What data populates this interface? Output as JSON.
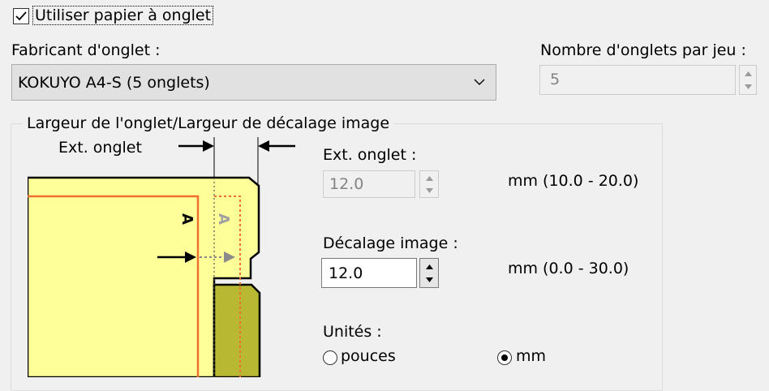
{
  "tab_paper": {
    "checkbox_label": "Utiliser papier à onglet",
    "checkbox_checked": true
  },
  "manufacturer": {
    "label": "Fabricant d'onglet :",
    "selected": "KOKUYO A4-S (5 onglets)"
  },
  "tabs_per_set": {
    "label": "Nombre d'onglets par jeu :",
    "value": "5"
  },
  "group": {
    "title": "Largeur de l'onglet/Largeur de décalage image",
    "illustration_label": "Ext. onglet",
    "illustration_tab_letter": "A"
  },
  "tab_extension": {
    "label": "Ext. onglet :",
    "value": "12.0",
    "range": "mm (10.0 - 20.0)"
  },
  "image_shift": {
    "label": "Décalage image :",
    "value": "12.0",
    "range": "mm (0.0 - 30.0)"
  },
  "units": {
    "label": "Unités :",
    "options": [
      "pouces",
      "mm"
    ],
    "selected": "mm"
  },
  "colors": {
    "paper_fill": "#ffff99",
    "tab_fill": "#b8b833",
    "margin_line": "#f07030"
  }
}
